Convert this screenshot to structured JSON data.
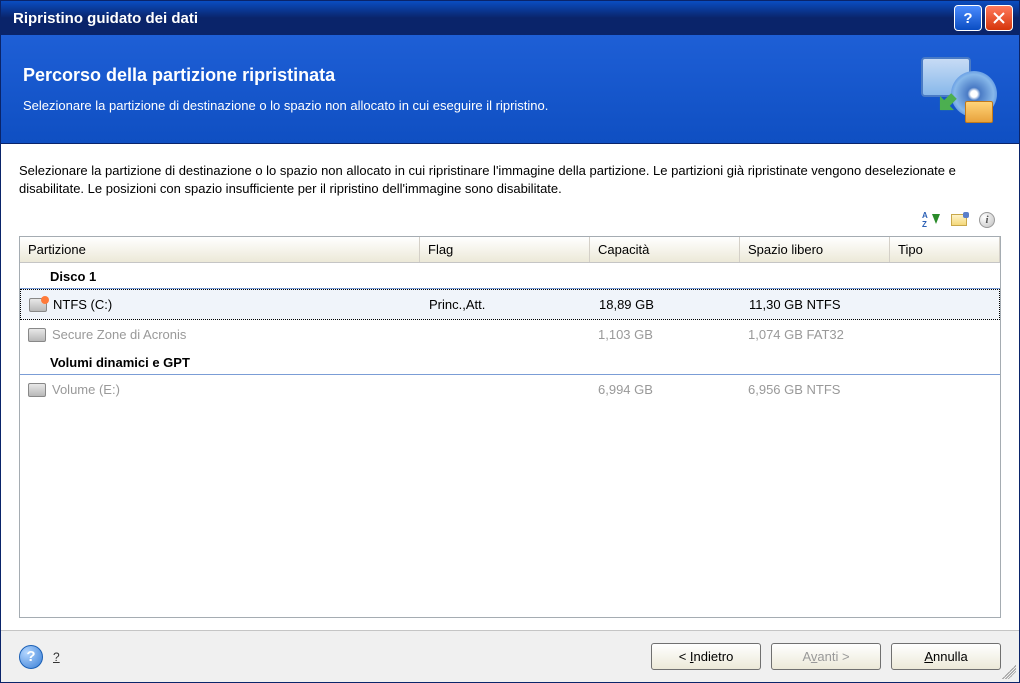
{
  "window": {
    "title": "Ripristino guidato dei dati"
  },
  "header": {
    "title": "Percorso della partizione ripristinata",
    "subtitle": "Selezionare la partizione di destinazione o lo spazio non allocato in cui eseguire il ripristino."
  },
  "instructions": "Selezionare la partizione di destinazione o lo spazio non allocato in cui ripristinare l'immagine della partizione. Le partizioni già ripristinate vengono deselezionate e disabilitate. Le posizioni con spazio insufficiente per il ripristino dell'immagine sono disabilitate.",
  "columns": {
    "partition": "Partizione",
    "flag": "Flag",
    "capacity": "Capacità",
    "free": "Spazio libero",
    "type": "Tipo"
  },
  "groups": [
    {
      "label": "Disco 1",
      "rows": [
        {
          "name": "NTFS (C:)",
          "flag": "Princ.,Att.",
          "capacity": "18,89 GB",
          "free": "11,30 GB",
          "type": "NTFS",
          "selected": true,
          "disabled": false
        },
        {
          "name": "Secure Zone di Acronis",
          "flag": "",
          "capacity": "1,103 GB",
          "free": "1,074 GB",
          "type": "FAT32",
          "selected": false,
          "disabled": true
        }
      ]
    },
    {
      "label": "Volumi dinamici e GPT",
      "rows": [
        {
          "name": "Volume (E:)",
          "flag": "",
          "capacity": "6,994 GB",
          "free": "6,956 GB",
          "type": "NTFS",
          "selected": false,
          "disabled": true
        }
      ]
    }
  ],
  "footer": {
    "help": "?",
    "back": "< Indietro",
    "next": "Avanti >",
    "cancel": "Annulla"
  }
}
